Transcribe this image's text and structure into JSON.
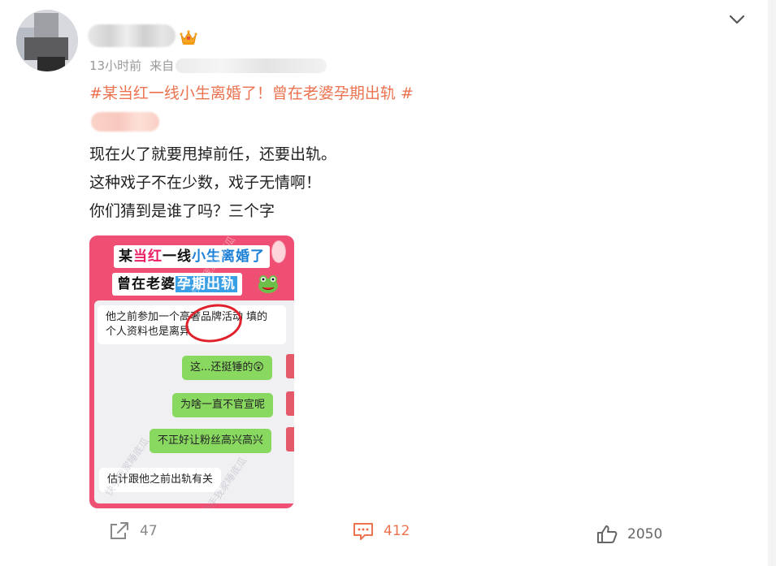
{
  "post": {
    "time": "13小时前",
    "from_label": "来自",
    "topic": "#某当红一线小生离婚了！曾在老婆孕期出轨 #",
    "lines": [
      "现在火了就要甩掉前任，还要出轨。",
      "这种戏子不在少数，戏子无情啊！",
      "你们猜到是谁了吗？三个字"
    ]
  },
  "image": {
    "title_line1_a": "某",
    "title_line1_b": "当红",
    "title_line1_c": "一线",
    "title_line1_d": "小生离婚了",
    "title_line2_a": "曾在老婆",
    "title_line2_b": "孕期出轨",
    "watermark": "快手我家睡底瓜",
    "chat": [
      "他之前参加一个高奢品牌活动 填的个人资料也是离异",
      "这...还挺锤的😲",
      "为啥一直不官宣呢",
      "不正好让粉丝高兴高兴",
      "估计跟他之前出轨有关"
    ]
  },
  "actions": {
    "share_count": "47",
    "comment_count": "412",
    "like_count": "2050"
  },
  "colors": {
    "accent": "#eb7350",
    "image_bg": "#ef4f72",
    "chat_green": "#89d961"
  },
  "icons": [
    "chevron-down-icon",
    "crown-icon",
    "share-icon",
    "comment-icon",
    "like-icon"
  ]
}
